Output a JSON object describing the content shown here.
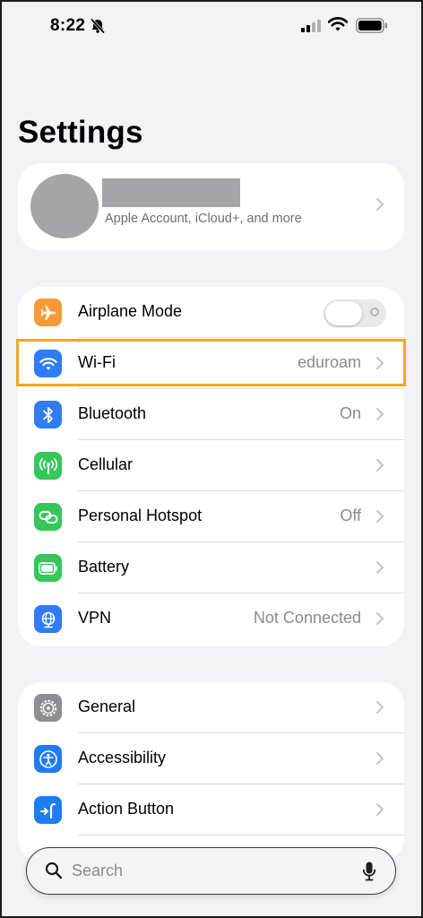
{
  "status_bar": {
    "time": "8:22"
  },
  "page": {
    "title": "Settings"
  },
  "account": {
    "subtitle": "Apple Account, iCloud+, and more"
  },
  "colors": {
    "background": "#f2f2f7",
    "highlight": "#f5a623",
    "airplane": "#f69a37",
    "wifi": "#2f7cf6",
    "bluetooth": "#2f7cf6",
    "cellular": "#34c759",
    "hotspot": "#34c759",
    "battery": "#34c759",
    "vpn": "#2f7cf6",
    "general": "#8e8e93",
    "accessibility": "#1e7cf4",
    "action_button": "#1e7cf4"
  },
  "group1": [
    {
      "id": "airplane-mode",
      "label": "Airplane Mode",
      "icon": "airplane-icon",
      "toggle": false
    },
    {
      "id": "wifi",
      "label": "Wi-Fi",
      "value": "eduroam",
      "icon": "wifi-icon"
    },
    {
      "id": "bluetooth",
      "label": "Bluetooth",
      "value": "On",
      "icon": "bluetooth-icon"
    },
    {
      "id": "cellular",
      "label": "Cellular",
      "icon": "antenna-icon"
    },
    {
      "id": "personal-hotspot",
      "label": "Personal Hotspot",
      "value": "Off",
      "icon": "link-icon"
    },
    {
      "id": "battery",
      "label": "Battery",
      "icon": "battery-icon"
    },
    {
      "id": "vpn",
      "label": "VPN",
      "value": "Not Connected",
      "icon": "globe-icon"
    }
  ],
  "group2": [
    {
      "id": "general",
      "label": "General",
      "icon": "gear-icon"
    },
    {
      "id": "accessibility",
      "label": "Accessibility",
      "icon": "accessibility-icon"
    },
    {
      "id": "action-button",
      "label": "Action Button",
      "icon": "action-button-icon"
    }
  ],
  "search": {
    "placeholder": "Search"
  }
}
